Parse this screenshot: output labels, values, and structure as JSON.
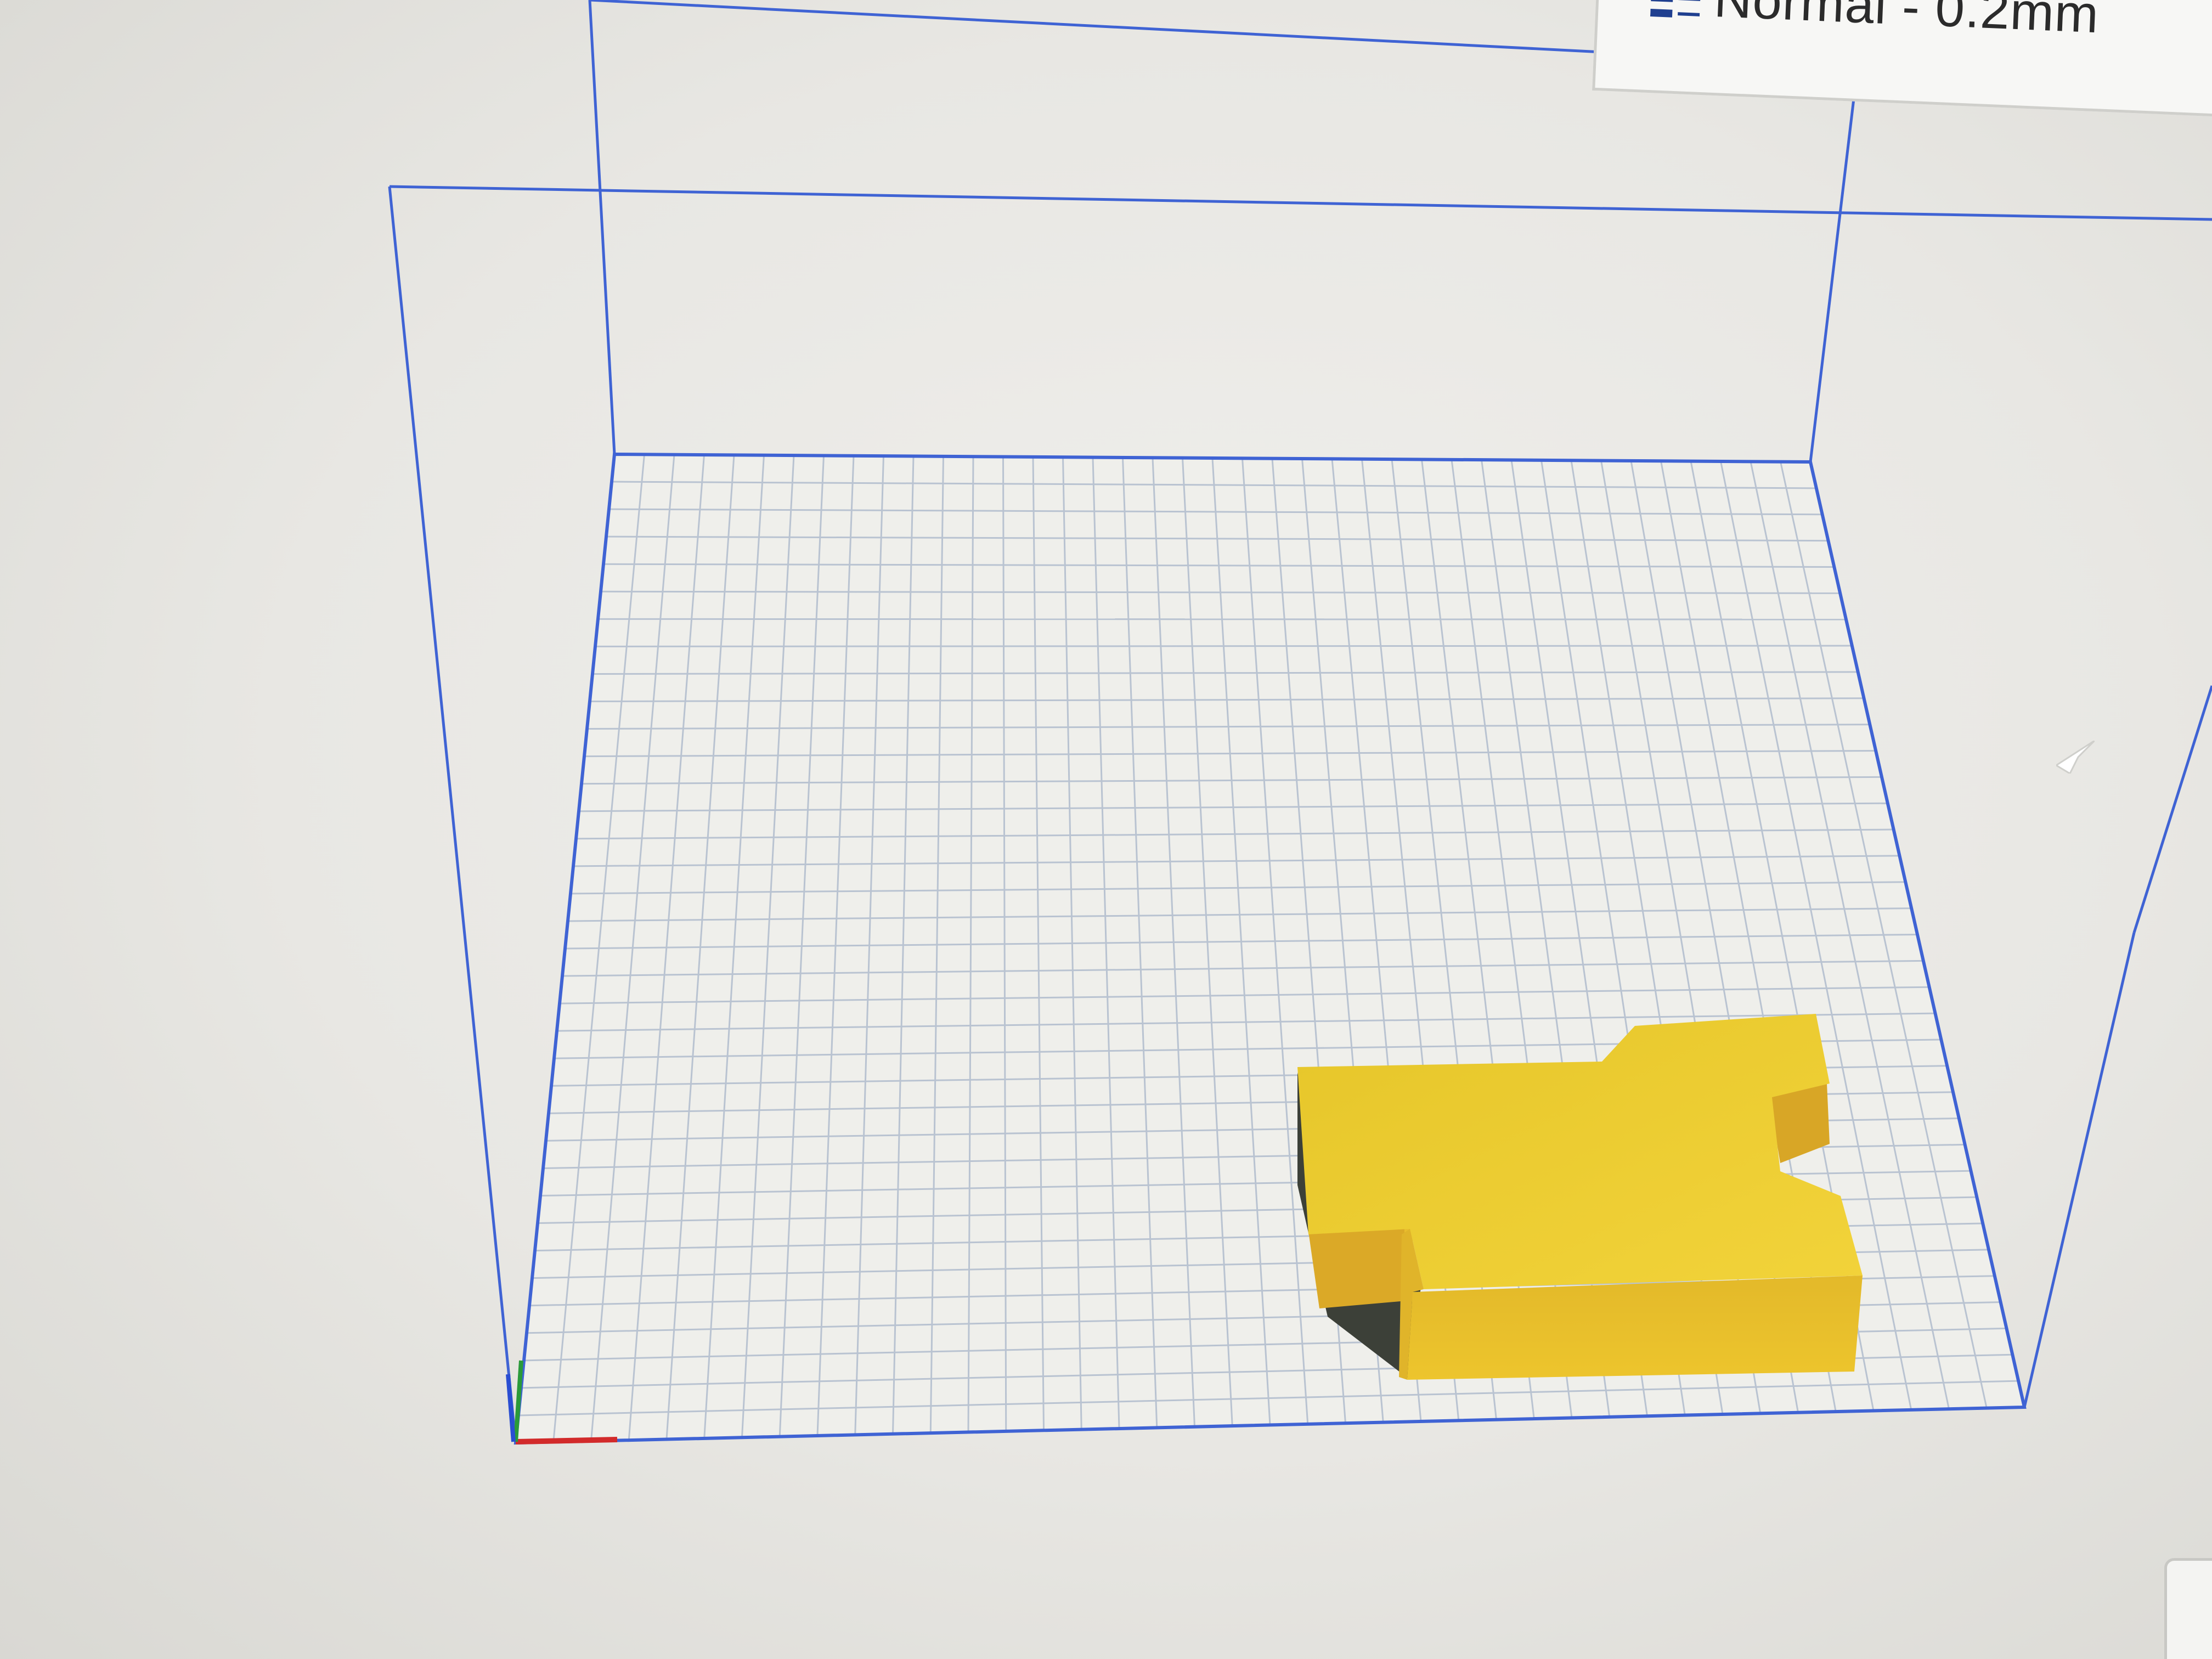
{
  "print_settings": {
    "profile_label": "Normal - 0.2mm",
    "profile_icon": "print-settings-icon"
  },
  "viewport": {
    "object_color": "#e8c62a",
    "bed_grid_color": "#b9c3d1",
    "volume_outline_color": "#3f63d4",
    "axis_colors": {
      "x": "#d22a2a",
      "y": "#2a9a3a",
      "z": "#2a4ed2"
    }
  },
  "icons": {
    "cursor": "mouse-cursor-icon",
    "corner_control": "view-control-icon"
  }
}
